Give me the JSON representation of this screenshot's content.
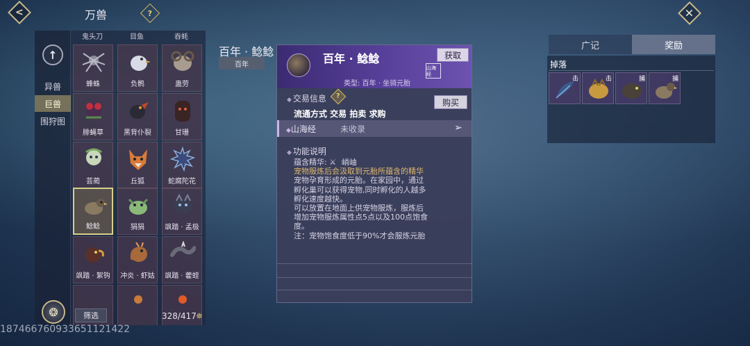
{
  "header": {
    "title": "万兽",
    "help_icon": "question-diamond-icon",
    "back_icon": "chevron-left-icon",
    "close_icon": "close-x-icon"
  },
  "sidebar": {
    "up_icon": "arrow-up-icon",
    "items": [
      {
        "label": "异兽",
        "active": false
      },
      {
        "label": "巨兽",
        "active": true
      },
      {
        "label": "围狩图",
        "active": false
      }
    ],
    "avatar_icon": "beast-portrait-icon"
  },
  "grid": {
    "top_partial": [
      "鬼头刀",
      "目鱼",
      "吞蚝"
    ],
    "cells": [
      {
        "name": "蜂蛛",
        "icon": "spider-icon"
      },
      {
        "name": "负鹘",
        "icon": "white-bird-icon"
      },
      {
        "name": "蛊劳",
        "icon": "ram-icon"
      },
      {
        "name": "腓蝇草",
        "icon": "plant-creature-icon"
      },
      {
        "name": "黑背仆裂",
        "icon": "black-bird-icon"
      },
      {
        "name": "甘珊",
        "icon": "dark-beast-icon"
      },
      {
        "name": "芸蔺",
        "icon": "fairy-icon"
      },
      {
        "name": "丘狐",
        "icon": "fox-icon"
      },
      {
        "name": "蛇腐陀花",
        "icon": "spiky-flower-icon"
      },
      {
        "name": "鲶鲶",
        "icon": "bird-beast-icon",
        "selected": true
      },
      {
        "name": "狷狷",
        "icon": "green-beast-icon"
      },
      {
        "name": "飒踏 · 孟极",
        "icon": "leopard-icon"
      },
      {
        "name": "飒踏 · 絮钩",
        "icon": "hooked-bird-icon"
      },
      {
        "name": "冲炎 · 虾姑",
        "icon": "shrimp-icon"
      },
      {
        "name": "飒踏 · 藿蛭",
        "icon": "leech-icon"
      }
    ],
    "filter_label": "筛选",
    "count": "328/417"
  },
  "background_title": "百年 · 鲶鲶",
  "background_badge": "百年",
  "popup": {
    "title": "百年 · 鲶鲶",
    "get_label": "获取",
    "type_text": "类型: 百年 · 坐骑元胎",
    "seal_text": "山海经",
    "trade_label": "交易信息",
    "buy_label": "购买",
    "trade_methods": "流通方式   交易 拍卖 求购",
    "shj_label": "山海经",
    "shj_status": "未收录",
    "func_label": "功能说明",
    "func_prefix": "蕴含精华:",
    "func_link": "峭岫",
    "func_highlight": "宠物服炼后会汲取到元胎所蕴含的精华",
    "func_lines": [
      "宠物孕育形成的元胎。在家园中，通过",
      "孵化巢可以获得宠物,同时孵化的人越多",
      "孵化速度越快。",
      "可以放置在地面上供宠物服炼，服炼后",
      "增加宠物服炼属性点5点以及100点饱食",
      "度。",
      "注：宠物饱食度低于90%才会服炼元胎"
    ]
  },
  "right_panel": {
    "tabs": [
      {
        "label": "广记",
        "active": false
      },
      {
        "label": "奖励",
        "active": true
      }
    ],
    "drops_label": "掉落",
    "drops": [
      {
        "tag": "击",
        "icon": "feather-item-icon"
      },
      {
        "tag": "击",
        "icon": "golden-beast-icon"
      },
      {
        "tag": "捕",
        "icon": "round-beast-icon"
      },
      {
        "tag": "捕",
        "icon": "bird-beast-icon"
      }
    ]
  },
  "watermark": "187466760933651121422"
}
